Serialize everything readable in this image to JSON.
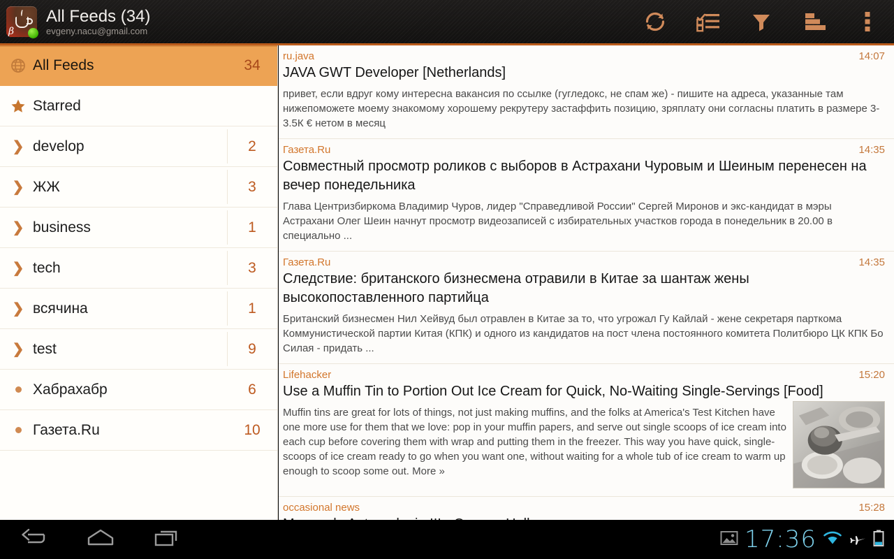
{
  "actionbar": {
    "app_icon_name": "coffee-cup-beta-icon",
    "app_icon_letter": "β",
    "title": "All Feeds (34)",
    "account": "evgeny.nacu@gmail.com",
    "accent_color": "#c8641d",
    "buttons": [
      {
        "name": "refresh-icon",
        "label": "Refresh"
      },
      {
        "name": "mark-read-checklist-icon",
        "label": "Mark all read"
      },
      {
        "name": "filter-funnel-icon",
        "label": "Filter"
      },
      {
        "name": "sort-bars-icon",
        "label": "Sort"
      },
      {
        "name": "overflow-menu-icon",
        "label": "More options"
      }
    ]
  },
  "sidebar": {
    "items": [
      {
        "label": "All Feeds",
        "count": "34",
        "icon": "globe-icon",
        "type": "all",
        "selected": true
      },
      {
        "label": "Starred",
        "count": "",
        "icon": "star-icon",
        "type": "starred",
        "selected": false
      },
      {
        "label": "develop",
        "count": "2",
        "icon": "chevron-right-icon",
        "type": "folder",
        "selected": false
      },
      {
        "label": "ЖЖ",
        "count": "3",
        "icon": "chevron-right-icon",
        "type": "folder",
        "selected": false
      },
      {
        "label": "business",
        "count": "1",
        "icon": "chevron-right-icon",
        "type": "folder",
        "selected": false
      },
      {
        "label": "tech",
        "count": "3",
        "icon": "chevron-right-icon",
        "type": "folder",
        "selected": false
      },
      {
        "label": "всячина",
        "count": "1",
        "icon": "chevron-right-icon",
        "type": "folder",
        "selected": false
      },
      {
        "label": "test",
        "count": "9",
        "icon": "chevron-right-icon",
        "type": "folder",
        "selected": false
      },
      {
        "label": "Хабрахабр",
        "count": "6",
        "icon": "dot-icon",
        "type": "feed",
        "selected": false
      },
      {
        "label": "Газета.Ru",
        "count": "10",
        "icon": "dot-icon",
        "type": "feed",
        "selected": false
      }
    ]
  },
  "articles": [
    {
      "feed": "ru.java",
      "time": "14:07",
      "title": "JAVA GWT Developer [Netherlands]",
      "snippet": "привет, если вдруг кому интересна вакансия по ссылке (гугледокс, не спам же) - пишите на адреса, указанные там нижепоможете моему знакомому хорошему рекрутеру застаффить позицию, зряплату они согласны платить в размере 3-3.5К € нетом в месяц",
      "has_thumb": false
    },
    {
      "feed": "Газета.Ru",
      "time": "14:35",
      "title": "Совместный просмотр роликов с выборов в Астрахани Чуровым и Шеиным перенесен на вечер понедельника",
      "snippet": "Глава Центризбиркома Владимир Чуров, лидер \"Справедливой России\" Сергей Миронов и экс-кандидат в мэры Астрахани Олег Шеин начнут просмотр видеозаписей с избирательных участков города в понедельник в 20.00 в специально ...",
      "has_thumb": false
    },
    {
      "feed": "Газета.Ru",
      "time": "14:35",
      "title": "Следствие: британского бизнесмена отравили в Китае за шантаж жены высокопоставленного партийца",
      "snippet": "Британский бизнесмен Нил Хейвуд был отравлен в Китае за то, что угрожал Гу Кайлай - жене секретаря парткома Коммунистической партии Китая (КПК) и одного из кандидатов на пост члена постоянного комитета Политбюро ЦК КПК Бо Силая - придать ...",
      "has_thumb": false
    },
    {
      "feed": "Lifehacker",
      "time": "15:20",
      "title": "Use a Muffin Tin to Portion Out Ice Cream for Quick, No-Waiting Single-Servings [Food]",
      "snippet": "Muffin tins are great for lots of things, not just making muffins, and the folks at America's Test Kitchen have one more use for them that we love: pop in your muffin papers, and serve out single scoops of ice cream into each cup before covering them with wrap and putting them in the freezer. This way you have quick, single-scoops of ice cream ready to go when you want one, without waiting for a whole tub of ice cream to warm up enough to scoop some out. More »",
      "has_thumb": true,
      "thumb_name": "article-thumbnail-muffin-tin"
    },
    {
      "feed": "occasional news",
      "time": "15:28",
      "title": "Museo de Antropologia III - Oaxaca Hall",
      "snippet": "",
      "has_thumb": false
    }
  ],
  "navbar": {
    "buttons": [
      {
        "name": "back-icon",
        "label": "Back"
      },
      {
        "name": "home-icon",
        "label": "Home"
      },
      {
        "name": "recent-apps-icon",
        "label": "Recent apps"
      }
    ],
    "status": {
      "screenshot_icon": "image-notification-icon",
      "clock": "17:36",
      "wifi_icon": "wifi-icon",
      "airplane_icon": "airplane-mode-icon",
      "battery_icon": "battery-icon",
      "clock_color": "#7fd4ef"
    }
  }
}
